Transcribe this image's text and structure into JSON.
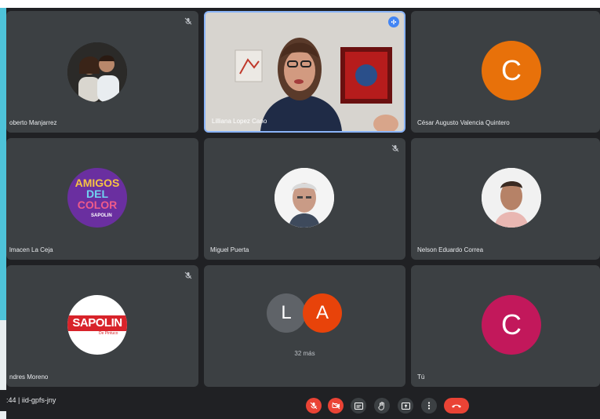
{
  "participants": [
    {
      "name": "oberto Manjarrez",
      "muted": true,
      "avatar_type": "photo-couple"
    },
    {
      "name": "Lilliana Lopez Cano",
      "speaking": true,
      "avatar_type": "video"
    },
    {
      "name": "César Augusto Valencia Quintero",
      "avatar_type": "letter",
      "letter": "C",
      "color": "#e8710a"
    },
    {
      "name": "lmacen La Ceja",
      "avatar_type": "logo-amigos",
      "logo_lines": [
        "AMIGOS",
        "DEL",
        "COLOR"
      ],
      "logo_brand": "SAPOLIN"
    },
    {
      "name": "Miguel Puerta",
      "muted": true,
      "avatar_type": "photo-man-gray"
    },
    {
      "name": "Nelson Eduardo Correa",
      "avatar_type": "photo-man-pink"
    },
    {
      "name": "ndres Moreno",
      "muted": true,
      "avatar_type": "logo-sapolin",
      "logo_text": "SAPOLIN",
      "logo_sub": "De Pintuco"
    },
    {
      "name": "",
      "avatar_type": "group",
      "group_letters": [
        "L",
        "A"
      ],
      "group_colors": [
        "#5f6368",
        "#e8430a"
      ],
      "more_label": "32 más"
    },
    {
      "name": "Tú",
      "avatar_type": "letter",
      "letter": "C",
      "color": "#c2185b"
    }
  ],
  "bottom_bar": {
    "meeting_code": ":44  |  iid-gpfs-jny",
    "controls": [
      "mic-off-icon",
      "camera-off-icon",
      "captions-icon",
      "raise-hand-icon",
      "present-icon",
      "more-icon",
      "hang-up-icon"
    ]
  }
}
